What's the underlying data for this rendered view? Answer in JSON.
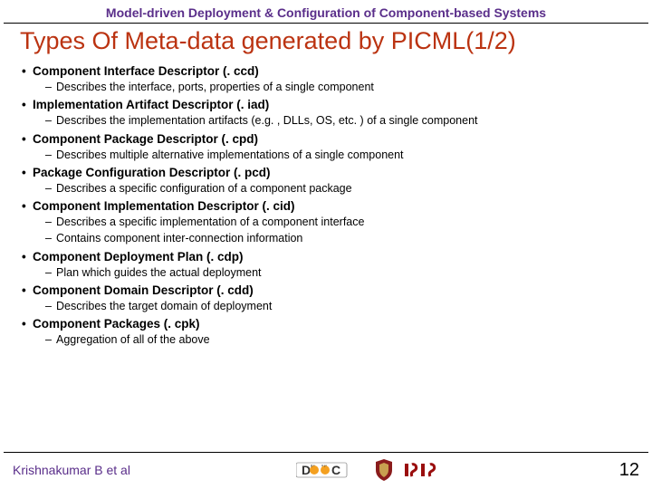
{
  "header": "Model-driven Deployment & Configuration of Component-based Systems",
  "title": "Types Of Meta-data generated by PICML(1/2)",
  "items": [
    {
      "heading": "Component Interface Descriptor (. ccd)",
      "subs": [
        "Describes the interface, ports, properties of a single component"
      ]
    },
    {
      "heading": "Implementation Artifact Descriptor (. iad)",
      "subs": [
        "Describes the implementation artifacts (e.g. , DLLs, OS, etc. ) of a single component"
      ]
    },
    {
      "heading": "Component Package Descriptor (. cpd)",
      "subs": [
        "Describes multiple alternative implementations of a single component"
      ]
    },
    {
      "heading": "Package Configuration Descriptor (. pcd)",
      "subs": [
        "Describes a specific configuration of a component package"
      ]
    },
    {
      "heading": "Component Implementation Descriptor (. cid)",
      "subs": [
        "Describes a specific implementation of a component interface",
        "Contains component inter-connection information"
      ]
    },
    {
      "heading": "Component Deployment Plan (. cdp)",
      "subs": [
        "Plan which guides the actual deployment"
      ]
    },
    {
      "heading": "Component Domain Descriptor (. cdd)",
      "subs": [
        "Describes the target domain of deployment"
      ]
    },
    {
      "heading": "Component Packages (. cpk)",
      "subs": [
        "Aggregation of all of the above"
      ]
    }
  ],
  "footer": {
    "author": "Krishnakumar B et al",
    "page": "12"
  }
}
